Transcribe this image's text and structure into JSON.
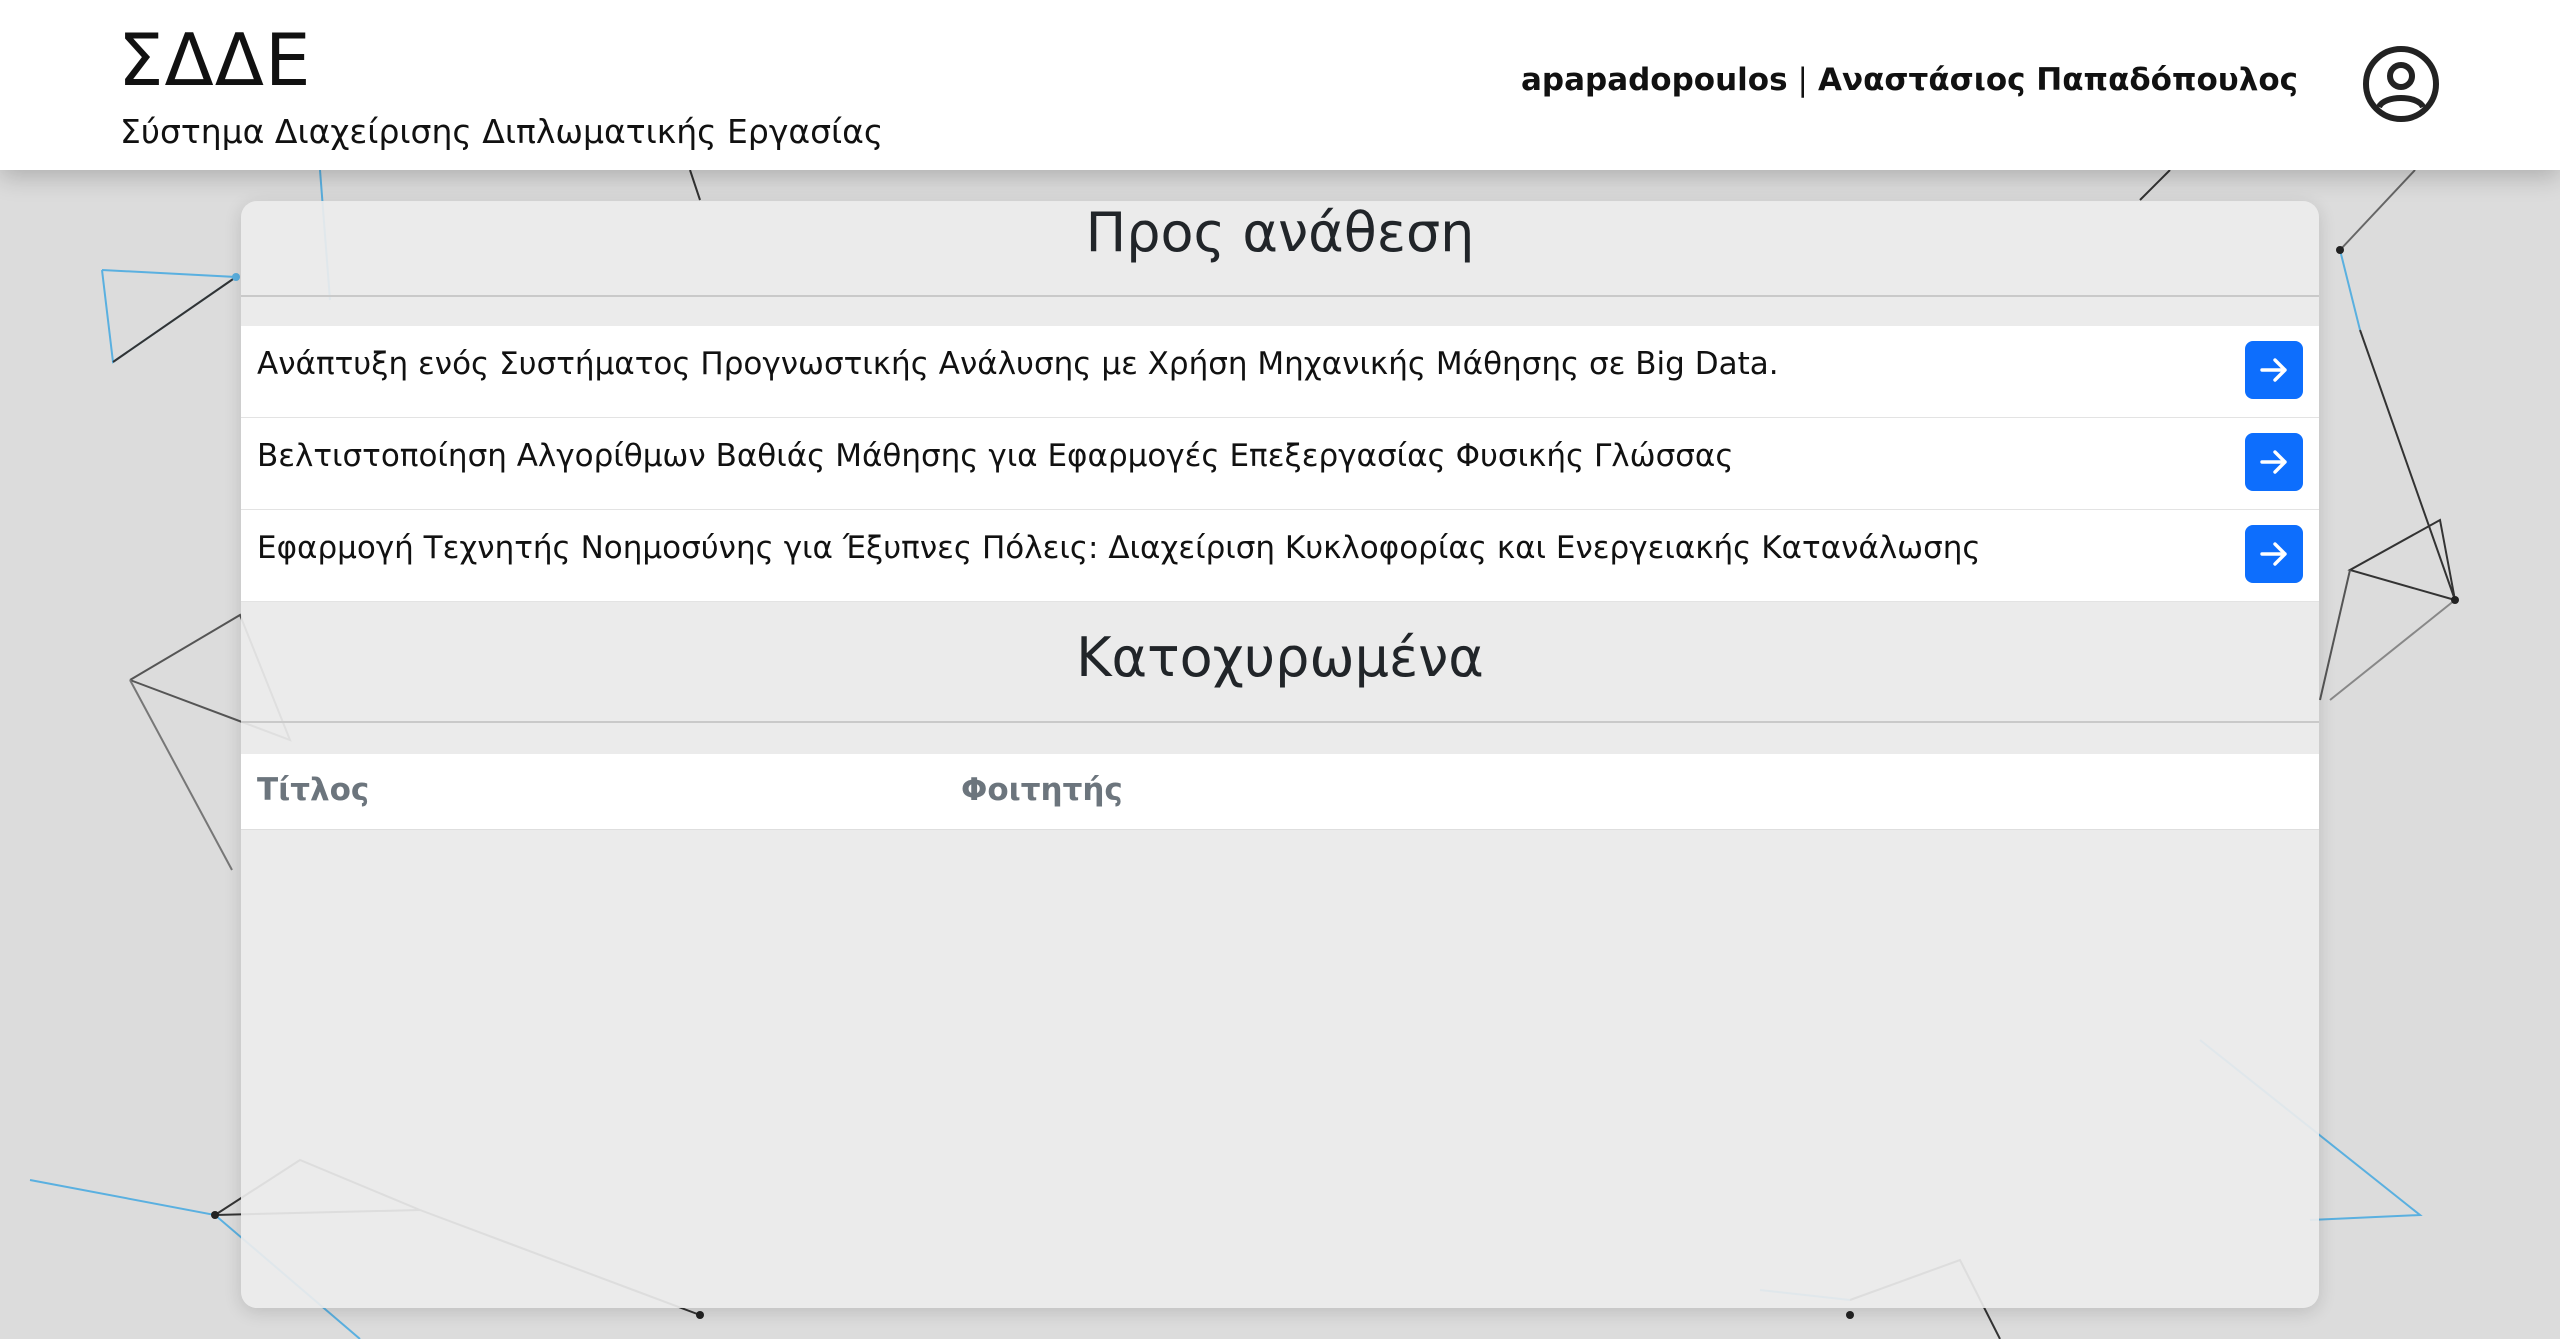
{
  "header": {
    "brand_title": "ΣΔΔΕ",
    "brand_subtitle": "Σύστημα Διαχείρισης Διπλωματικής Εργασίας",
    "username": "apapadopoulos",
    "separator": "|",
    "full_name": "Αναστάσιος Παπαδόπουλος",
    "user_icon": "user-circle-icon"
  },
  "to_assign": {
    "title": "Προς ανάθεση",
    "items": [
      {
        "title": "Ανάπτυξη ενός Συστήματος Προγνωστικής Ανάλυσης με Χρήση Μηχανικής Μάθησης σε Big Data.",
        "action_icon": "arrow-right-icon"
      },
      {
        "title": "Βελτιστοποίηση Αλγορίθμων Βαθιάς Μάθησης για Εφαρμογές Επεξεργασίας Φυσικής Γλώσσας",
        "action_icon": "arrow-right-icon"
      },
      {
        "title": "Εφαρμογή Τεχνητής Νοημοσύνης για Έξυπνες Πόλεις: Διαχείριση Κυκλοφορίας και Ενεργειακής Κατανάλωσης",
        "action_icon": "arrow-right-icon"
      }
    ]
  },
  "assigned": {
    "title": "Κατοχυρωμένα",
    "columns": [
      "Τίτλος",
      "Φοιτητής"
    ],
    "rows": []
  },
  "colors": {
    "accent": "#0d6efd",
    "header_bg": "#ffffff",
    "panel_bg": "#ececec",
    "page_bg": "#dcdcdc"
  }
}
